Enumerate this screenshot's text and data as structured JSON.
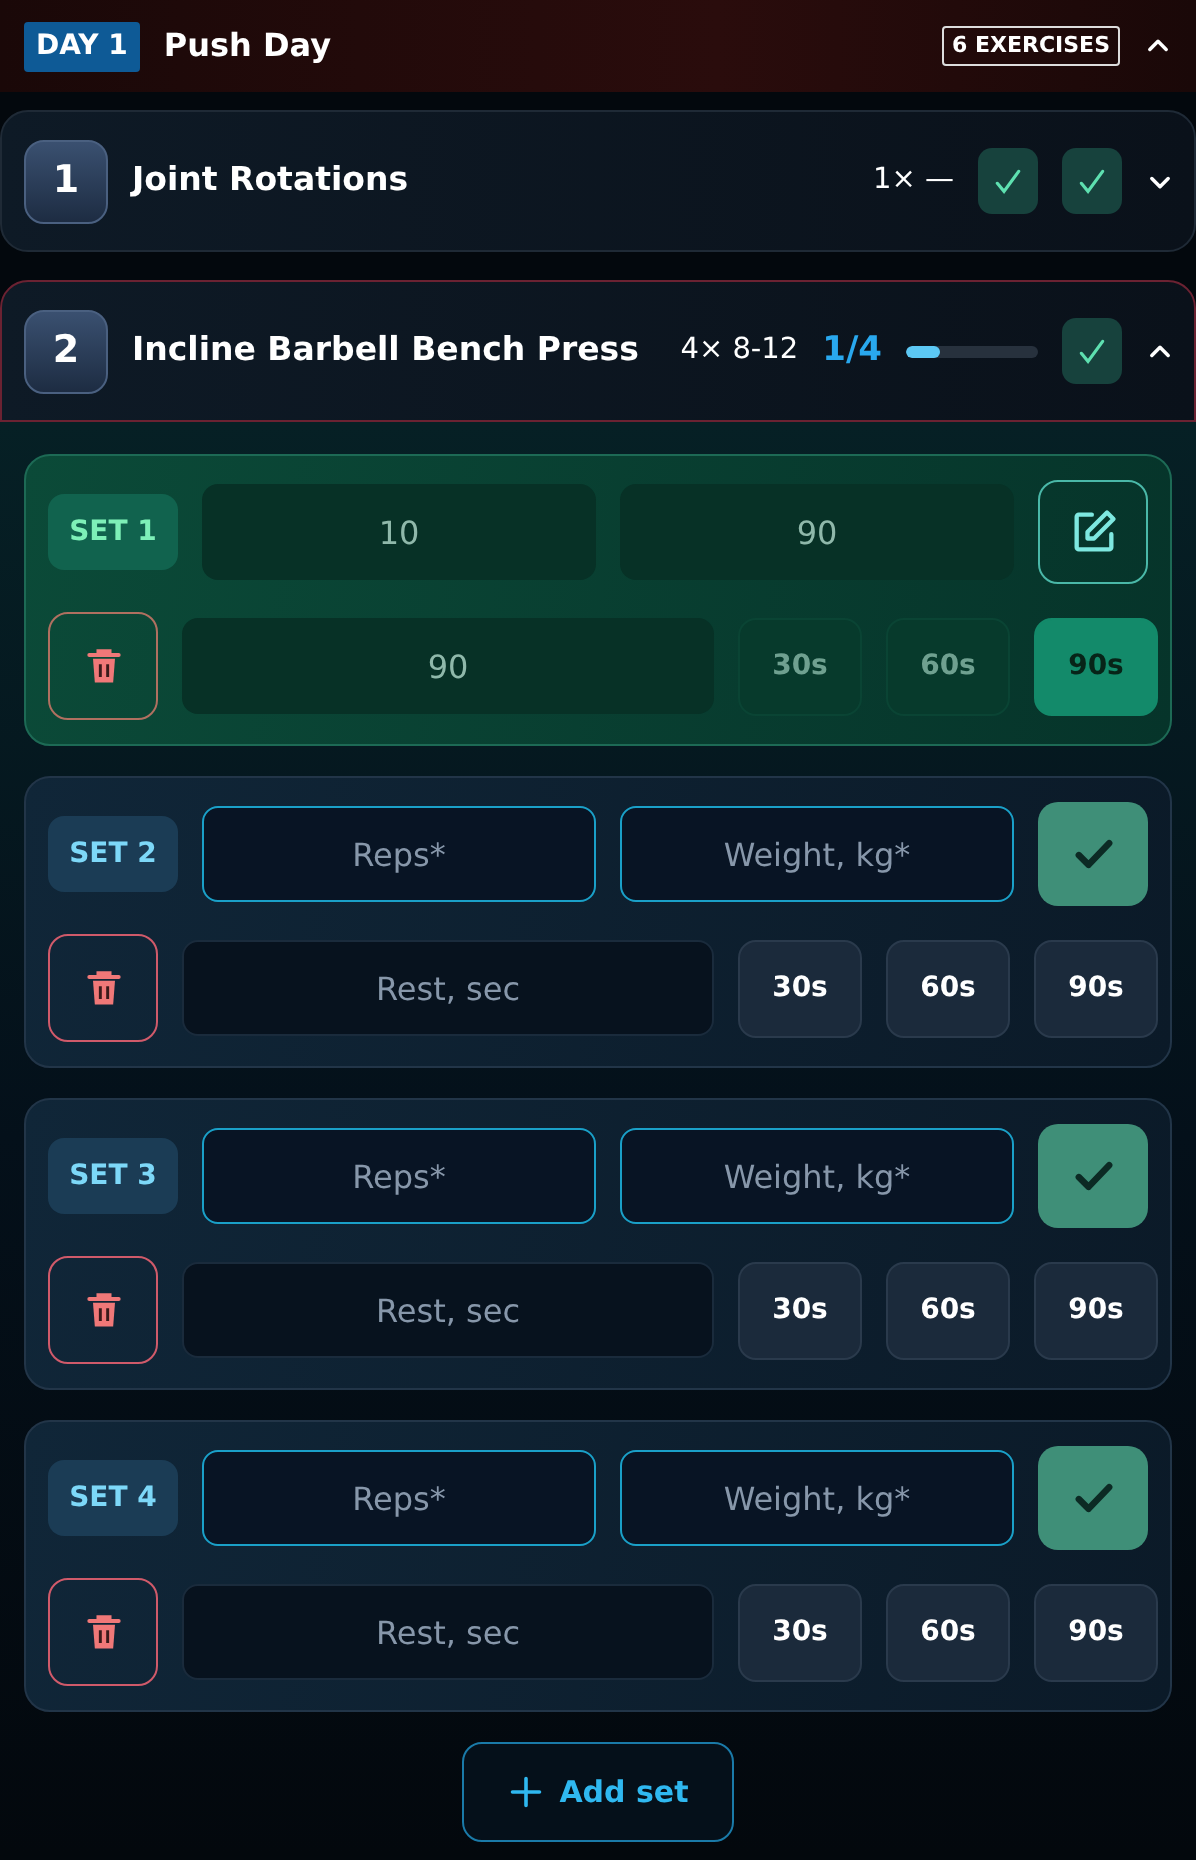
{
  "day": {
    "badge": "DAY 1",
    "title": "Push Day",
    "count": "6 EXERCISES",
    "expanded": true
  },
  "exercises": [
    {
      "number": "1",
      "name": "Joint Rotations",
      "scheme": "1× —",
      "check_buttons": [
        {
          "checked": true
        },
        {
          "checked": true
        }
      ],
      "expanded": false
    },
    {
      "number": "2",
      "name": "Incline Barbell Bench Press",
      "scheme": "4× 8-12",
      "progress": "1/4",
      "level": 0.25,
      "check_buttons": [
        {
          "checked": true
        }
      ],
      "expanded": true,
      "sets": [
        {
          "label": "SET 1",
          "done": true,
          "reps": {
            "value": "10"
          },
          "weight": {
            "value": "90"
          },
          "rest": {
            "value": "90"
          },
          "presets": [
            {
              "label": "30s",
              "selected": false
            },
            {
              "label": "60s",
              "selected": false
            },
            {
              "label": "90s",
              "selected": true
            }
          ]
        },
        {
          "label": "SET 2",
          "done": false,
          "reps": {
            "placeholder": "Reps*"
          },
          "weight": {
            "placeholder": "Weight, kg*"
          },
          "rest": {
            "placeholder": "Rest, sec"
          },
          "presets": [
            {
              "label": "30s",
              "selected": false
            },
            {
              "label": "60s",
              "selected": false
            },
            {
              "label": "90s",
              "selected": false
            }
          ]
        },
        {
          "label": "SET 3",
          "done": false,
          "reps": {
            "placeholder": "Reps*"
          },
          "weight": {
            "placeholder": "Weight, kg*"
          },
          "rest": {
            "placeholder": "Rest, sec"
          },
          "presets": [
            {
              "label": "30s",
              "selected": false
            },
            {
              "label": "60s",
              "selected": false
            },
            {
              "label": "90s",
              "selected": false
            }
          ]
        },
        {
          "label": "SET 4",
          "done": false,
          "reps": {
            "placeholder": "Reps*"
          },
          "weight": {
            "placeholder": "Weight, kg*"
          },
          "rest": {
            "placeholder": "Rest, sec"
          },
          "presets": [
            {
              "label": "30s",
              "selected": false
            },
            {
              "label": "60s",
              "selected": false
            },
            {
              "label": "90s",
              "selected": false
            }
          ]
        }
      ],
      "add_button": "Add set"
    }
  ]
}
